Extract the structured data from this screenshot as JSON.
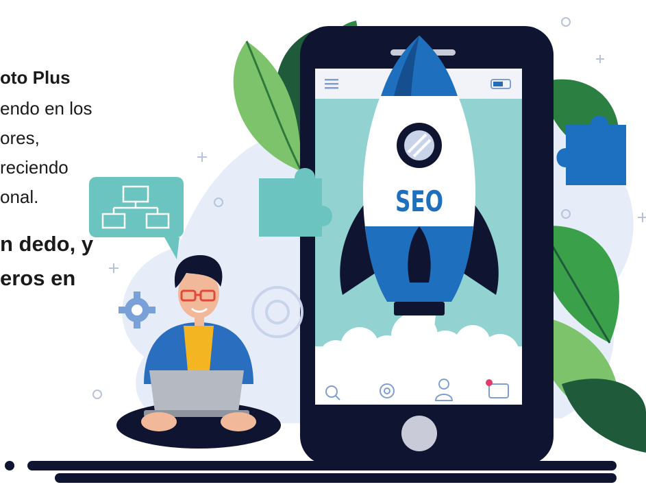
{
  "text": {
    "partial_top": "...",
    "line_1": "oto Plus",
    "line_2": "endo en los",
    "line_3": "ores,",
    "line_4": "reciendo",
    "line_5": "onal.",
    "line_6": "n dedo, y",
    "line_7": "eros en"
  },
  "illustration": {
    "rocket_label": "SEO",
    "colors": {
      "blob": "#e6edf8",
      "phone_body": "#0f1530",
      "screen_bg": "#92d3d2",
      "rocket_blue": "#1f6fbf",
      "rocket_white": "#ffffff",
      "puzzle_teal": "#6cc4c1",
      "puzzle_blue": "#1d6fc0",
      "leaf_green": "#3aa14a",
      "leaf_light": "#7cc36b",
      "shirt_blue": "#2a6fbf",
      "shirt_yellow": "#f3b521",
      "laptop_gray": "#b5b9c2"
    },
    "icons": [
      "menu-icon",
      "battery-icon",
      "search-icon",
      "settings-icon",
      "user-icon",
      "chat-icon",
      "sitemap-icon",
      "gear-icon"
    ]
  }
}
